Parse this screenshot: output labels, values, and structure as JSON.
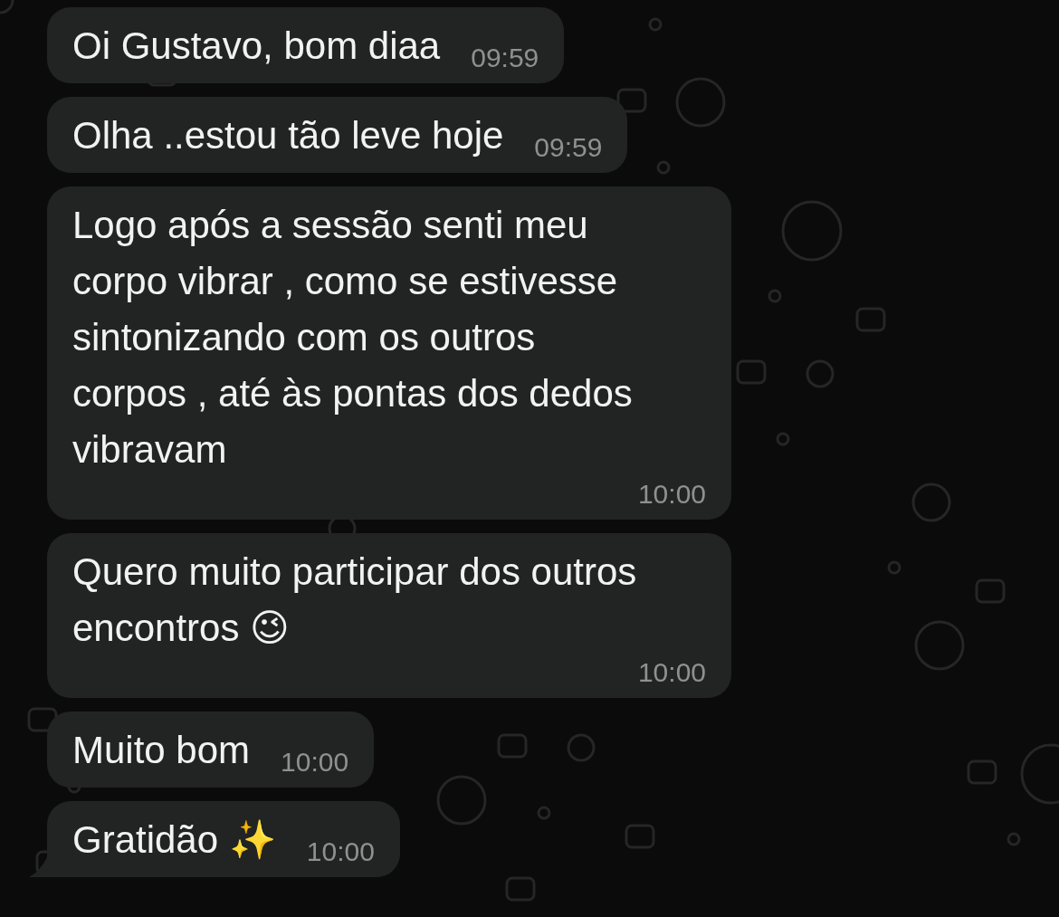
{
  "messages": [
    {
      "text": "Oi Gustavo, bom diaa",
      "time": "09:59",
      "tail": false
    },
    {
      "text": "Olha ..estou tão leve hoje",
      "time": "09:59",
      "tail": false
    },
    {
      "text": "Logo após a sessão senti meu corpo vibrar , como se estivesse sintonizando com os outros corpos , até às pontas dos dedos vibravam",
      "time": "10:00",
      "tail": false
    },
    {
      "text": "Quero muito participar dos outros encontros 😉",
      "time": "10:00",
      "tail": false
    },
    {
      "text": "Muito bom",
      "time": "10:00",
      "tail": false
    },
    {
      "text": "Gratidão ✨",
      "time": "10:00",
      "tail": true
    }
  ]
}
